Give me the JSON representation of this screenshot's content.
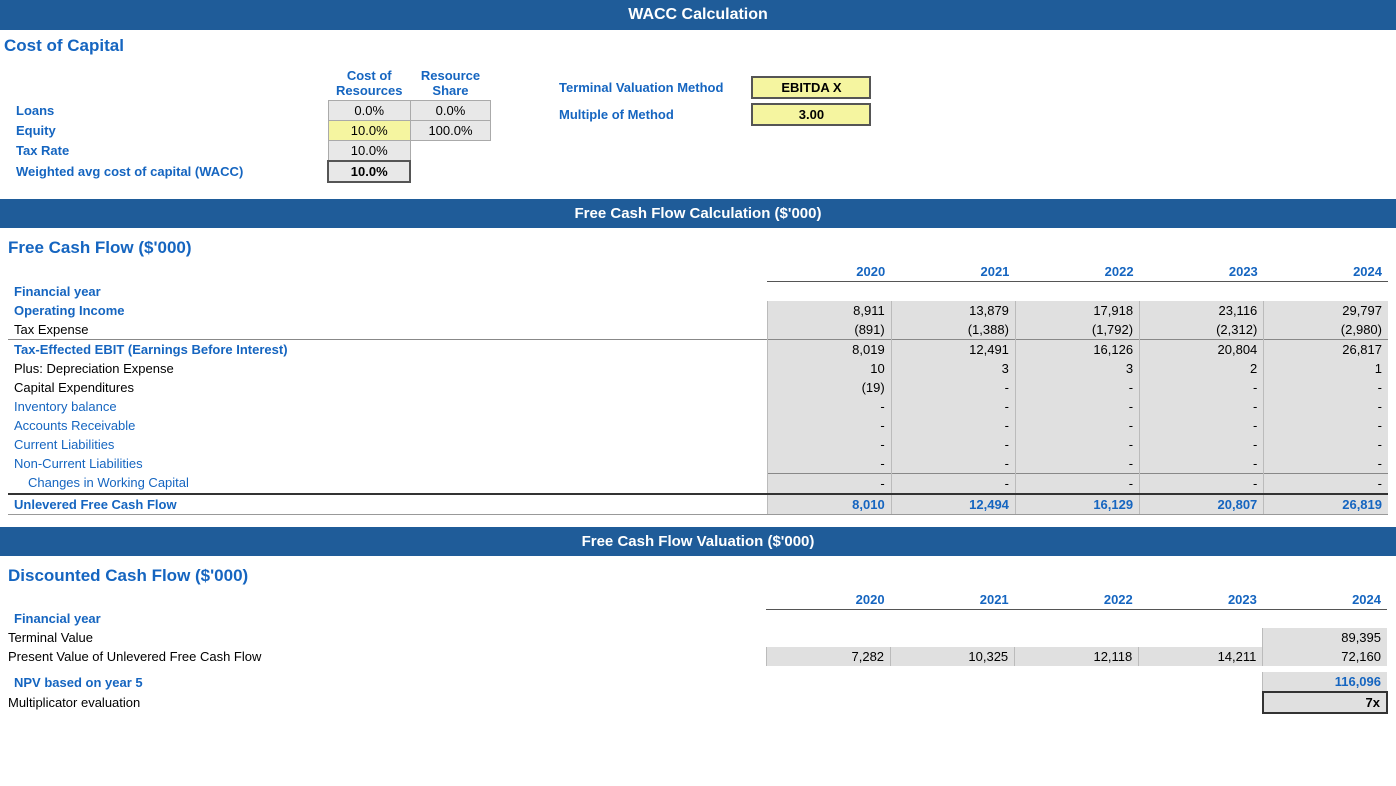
{
  "mainTitle": "WACC Calculation",
  "costOfCapital": {
    "sectionHeader": "Cost of Capital",
    "colHeaders": [
      "Cost of Resources",
      "Resource Share"
    ],
    "rows": [
      {
        "label": "Loans",
        "costOfResources": "0.0%",
        "resourceShare": "0.0%",
        "labelStyle": "bold"
      },
      {
        "label": "Equity",
        "costOfResources": "10.0%",
        "resourceShare": "100.0%",
        "labelStyle": "bold"
      },
      {
        "label": "Tax Rate",
        "costOfResources": "10.0%",
        "resourceShare": "",
        "labelStyle": "bold"
      },
      {
        "label": "Weighted avg cost of capital (WACC)",
        "costOfResources": "10.0%",
        "resourceShare": "",
        "labelStyle": "bold"
      }
    ],
    "terminal": {
      "label1": "Terminal Valuation Method",
      "label2": "Multiple of Method",
      "value1": "EBITDA X",
      "value2": "3.00"
    }
  },
  "fcfSectionTitle": "Free Cash Flow Calculation ($'000)",
  "fcf": {
    "sectionHeader": "Free Cash Flow ($'000)",
    "years": [
      "2020",
      "2021",
      "2022",
      "2023",
      "2024"
    ],
    "financialYearLabel": "Financial year",
    "rows": [
      {
        "label": "Operating Income",
        "style": "bold",
        "values": [
          "8,911",
          "13,879",
          "17,918",
          "23,116",
          "29,797"
        ]
      },
      {
        "label": "Tax Expense",
        "style": "indent1",
        "values": [
          "(891)",
          "(1,388)",
          "(1,792)",
          "(2,312)",
          "(2,980)"
        ]
      },
      {
        "label": "Tax-Effected EBIT (Earnings Before Interest)",
        "style": "bold",
        "values": [
          "8,019",
          "12,491",
          "16,126",
          "20,804",
          "26,817"
        ]
      },
      {
        "label": "Plus: Depreciation Expense",
        "style": "indent1",
        "values": [
          "10",
          "3",
          "3",
          "2",
          "1"
        ]
      },
      {
        "label": "Capital Expenditures",
        "style": "indent1",
        "values": [
          "(19)",
          "-",
          "-",
          "-",
          "-"
        ]
      },
      {
        "label": "Inventory balance",
        "style": "indent2",
        "values": [
          "-",
          "-",
          "-",
          "-",
          "-"
        ]
      },
      {
        "label": "Accounts Receivable",
        "style": "indent2",
        "values": [
          "-",
          "-",
          "-",
          "-",
          "-"
        ]
      },
      {
        "label": "Current Liabilities",
        "style": "indent2",
        "values": [
          "-",
          "-",
          "-",
          "-",
          "-"
        ]
      },
      {
        "label": "Non-Current Liabilities",
        "style": "indent2",
        "values": [
          "-",
          "-",
          "-",
          "-",
          "-"
        ]
      },
      {
        "label": "Changes in Working Capital",
        "style": "indent1blue",
        "values": [
          "-",
          "-",
          "-",
          "-",
          "-"
        ]
      },
      {
        "label": "Unlevered Free Cash Flow",
        "style": "bold-total",
        "values": [
          "8,010",
          "12,494",
          "16,129",
          "20,807",
          "26,819"
        ]
      }
    ]
  },
  "valuationSectionTitle": "Free Cash Flow Valuation ($'000)",
  "dcf": {
    "sectionHeader": "Discounted Cash Flow ($'000)",
    "years": [
      "2020",
      "2021",
      "2022",
      "2023",
      "2024"
    ],
    "financialYearLabel": "Financial year",
    "rows": [
      {
        "label": "Terminal Value",
        "style": "normal",
        "values": [
          "",
          "",
          "",
          "",
          "89,395"
        ]
      },
      {
        "label": "Present Value of Unlevered Free Cash Flow",
        "style": "normal",
        "values": [
          "7,282",
          "10,325",
          "12,118",
          "14,211",
          "72,160"
        ]
      }
    ],
    "npvLabel": "NPV based on year 5",
    "npvValue": "116,096",
    "multLabel": "Multiplicator evaluation",
    "multValue": "7x"
  }
}
